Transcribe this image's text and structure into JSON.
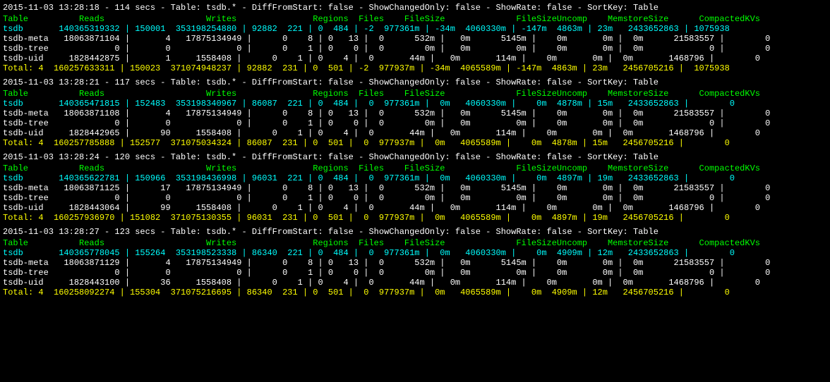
{
  "sections": [
    {
      "id": "section1",
      "header": "2015-11-03 13:28:18 - 114 secs - Table: tsdb.* - DiffFromStart: false - ShowChangedOnly: false - ShowRate: false - SortKey: Table",
      "columns": "Table          Reads                    Writes               Regions  Files    FileSize              FileSizeUncomp    MemstoreSize      CompactedKVs",
      "rows": [
        {
          "type": "tsdb",
          "text": "tsdb       140365319332 | 150001  353198254880 | 92882  221 | 0  484 | -2  977361m | -34m  4060330m | -147m  4863m | 23m   2433652863 | 1075938"
        },
        {
          "type": "meta",
          "text": "tsdb-meta   18063871104 |       4   17875134949 |      0    8 | 0   13 |  0      532m |   0m      5145m |    0m       0m |  0m      21583557 |        0"
        },
        {
          "type": "tree",
          "text": "tsdb-tree             0 |       0             0 |      0    1 | 0    0 |  0        0m |   0m         0m |    0m       0m |  0m             0 |        0"
        },
        {
          "type": "uid",
          "text": "tsdb-uid     1828442875 |       1     1558408 |      0    1 | 0    4 |  0       44m |   0m       114m |    0m       0m |  0m       1468796 |        0"
        },
        {
          "type": "total",
          "text": "Total: 4  160257633311 | 150023  371074948237 | 92882  231 | 0  501 | -2  977937m | -34m  4065589m | -147m  4863m | 23m   2456705216 |  1075938"
        }
      ]
    },
    {
      "id": "section2",
      "header": "2015-11-03 13:28:21 - 117 secs - Table: tsdb.* - DiffFromStart: false - ShowChangedOnly: false - ShowRate: false - SortKey: Table",
      "columns": "Table          Reads                    Writes               Regions  Files    FileSize              FileSizeUncomp    MemstoreSize      CompactedKVs",
      "rows": [
        {
          "type": "tsdb",
          "text": "tsdb       140365471815 | 152483  353198340967 | 86087  221 | 0  484 |  0  977361m |  0m   4060330m |    0m  4878m | 15m   2433652863 |        0"
        },
        {
          "type": "meta",
          "text": "tsdb-meta   18063871108 |       4   17875134949 |      0    8 | 0   13 |  0      532m |   0m      5145m |    0m       0m |  0m      21583557 |        0"
        },
        {
          "type": "tree",
          "text": "tsdb-tree             0 |       0             0 |      0    1 | 0    0 |  0        0m |   0m         0m |    0m       0m |  0m             0 |        0"
        },
        {
          "type": "uid",
          "text": "tsdb-uid     1828442965 |      90     1558408 |      0    1 | 0    4 |  0       44m |   0m       114m |    0m       0m |  0m       1468796 |        0"
        },
        {
          "type": "total",
          "text": "Total: 4  160257785888 | 152577  371075034324 | 86087  231 | 0  501 |  0  977937m |  0m   4065589m |    0m  4878m | 15m   2456705216 |        0"
        }
      ]
    },
    {
      "id": "section3",
      "header": "2015-11-03 13:28:24 - 120 secs - Table: tsdb.* - DiffFromStart: false - ShowChangedOnly: false - ShowRate: false - SortKey: Table",
      "columns": "Table          Reads                    Writes               Regions  Files    FileSize              FileSizeUncomp    MemstoreSize      CompactedKVs",
      "rows": [
        {
          "type": "tsdb",
          "text": "tsdb       140365622781 | 150966  353198436998 | 96031  221 | 0  484 |  0  977361m |  0m   4060330m |    0m  4897m | 19m   2433652863 |        0"
        },
        {
          "type": "meta",
          "text": "tsdb-meta   18063871125 |      17   17875134949 |      0    8 | 0   13 |  0      532m |   0m      5145m |    0m       0m |  0m      21583557 |        0"
        },
        {
          "type": "tree",
          "text": "tsdb-tree             0 |       0             0 |      0    1 | 0    0 |  0        0m |   0m         0m |    0m       0m |  0m             0 |        0"
        },
        {
          "type": "uid",
          "text": "tsdb-uid     1828443064 |      99     1558408 |      0    1 | 0    4 |  0       44m |   0m       114m |    0m       0m |  0m       1468796 |        0"
        },
        {
          "type": "total",
          "text": "Total: 4  160257936970 | 151082  371075130355 | 96031  231 | 0  501 |  0  977937m |  0m   4065589m |    0m  4897m | 19m   2456705216 |        0"
        }
      ]
    },
    {
      "id": "section4",
      "header": "2015-11-03 13:28:27 - 123 secs - Table: tsdb.* - DiffFromStart: false - ShowChangedOnly: false - ShowRate: false - SortKey: Table",
      "columns": "Table          Reads                    Writes               Regions  Files    FileSize              FileSizeUncomp    MemstoreSize      CompactedKVs",
      "rows": [
        {
          "type": "tsdb",
          "text": "tsdb       140365778045 | 155264  353198523338 | 86340  221 | 0  484 |  0  977361m |  0m   4060330m |    0m  4909m | 12m   2433652863 |        0"
        },
        {
          "type": "meta",
          "text": "tsdb-meta   18063871129 |       4   17875134949 |      0    8 | 0   13 |  0      532m |   0m      5145m |    0m       0m |  0m      21583557 |        0"
        },
        {
          "type": "tree",
          "text": "tsdb-tree             0 |       0             0 |      0    1 | 0    0 |  0        0m |   0m         0m |    0m       0m |  0m             0 |        0"
        },
        {
          "type": "uid",
          "text": "tsdb-uid     1828443100 |      36     1558408 |      0    1 | 0    4 |  0       44m |   0m       114m |    0m       0m |  0m       1468796 |        0"
        },
        {
          "type": "total",
          "text": "Total: 4  160258092274 | 155304  371075216695 | 86340  231 | 0  501 |  0  977937m |  0m   4065589m |    0m  4909m | 12m   2456705216 |        0"
        }
      ]
    }
  ],
  "col_header": {
    "table": "Table",
    "reads": "Reads",
    "writes": "Writes",
    "regions": "Regions",
    "files": "Files",
    "filesize": "FileSize",
    "filesizeuncomp": "FileSizeUncomp",
    "memstoresize": "MemstoreSize",
    "compactedkvs": "CompactedKVs"
  }
}
